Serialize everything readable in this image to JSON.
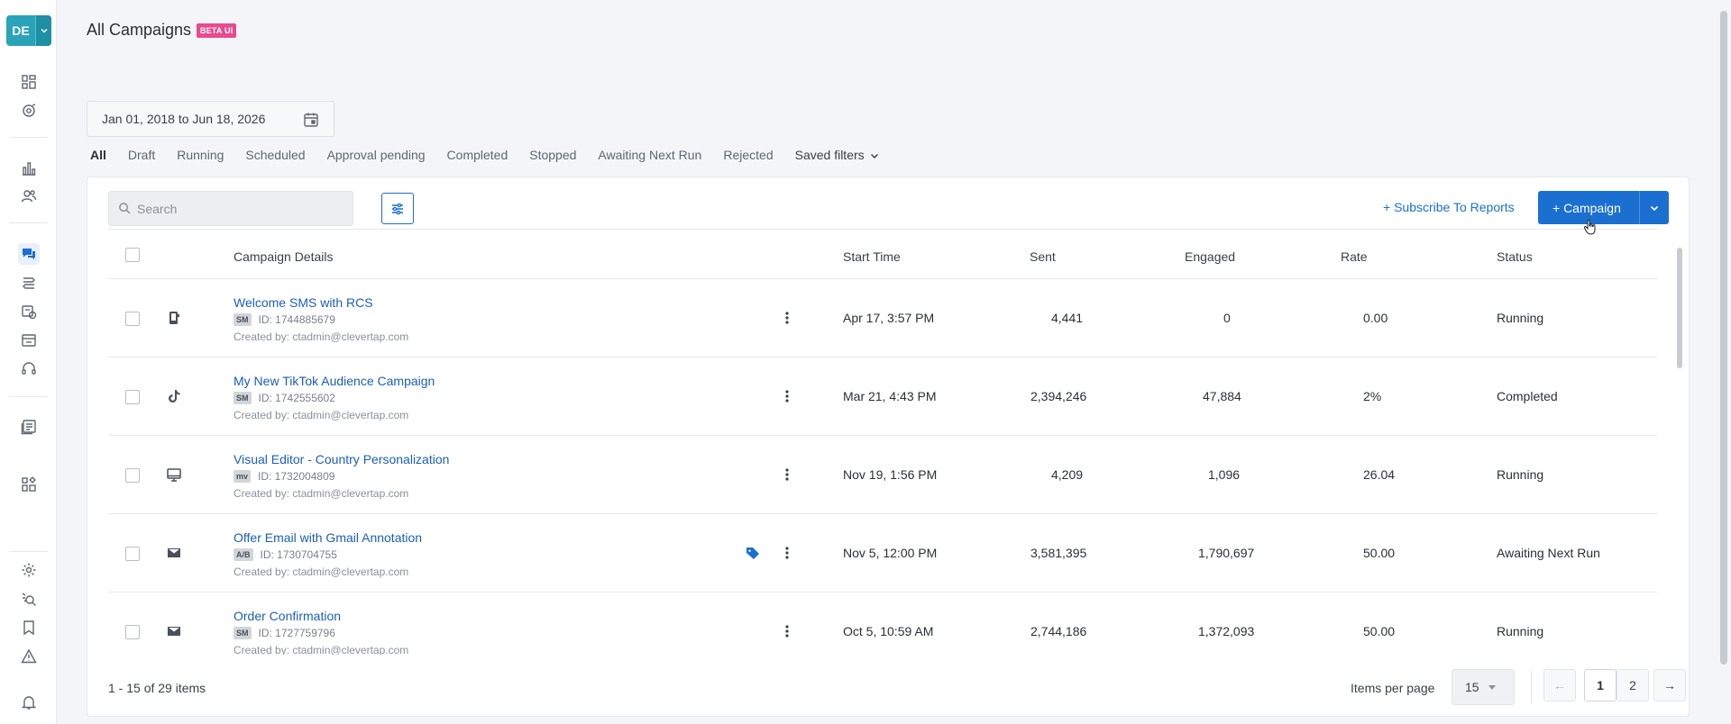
{
  "sidebar": {
    "workspace_initials": "DE",
    "icons": [
      "dashboard-icon",
      "segments-icon",
      "analytics-icon",
      "users-icon",
      "campaigns-icon",
      "journeys-icon",
      "offers-icon",
      "catalog-icon",
      "support-icon",
      "templates-icon",
      "apps-icon",
      "settings-icon",
      "search-debug-icon",
      "bookmark-icon",
      "alert-icon",
      "notifications-icon"
    ]
  },
  "header": {
    "title": "All Campaigns",
    "badge": "BETA UI"
  },
  "date_range": "Jan 01, 2018 to Jun 18, 2026",
  "filter_tabs": [
    "All",
    "Draft",
    "Running",
    "Scheduled",
    "Approval pending",
    "Completed",
    "Stopped",
    "Awaiting Next Run",
    "Rejected",
    "Saved filters"
  ],
  "toolbar": {
    "search_placeholder": "Search",
    "subscribe_label": "+ Subscribe To Reports",
    "campaign_label": "+  Campaign"
  },
  "table": {
    "columns": [
      "Campaign Details",
      "Start Time",
      "Sent",
      "Engaged",
      "Rate",
      "Status"
    ],
    "rows": [
      {
        "name": "Welcome SMS with RCS",
        "tag": "SM",
        "id": "ID: 1744885679",
        "creator": "Created by: ctadmin@clevertap.com",
        "channel_icon": "rcs-phone-icon",
        "start": "Apr 17, 3:57 PM",
        "sent": "4,441",
        "engaged": "0",
        "rate": "0.00",
        "status": "Running",
        "labelled": false
      },
      {
        "name": "My New TikTok Audience Campaign",
        "tag": "SM",
        "id": "ID: 1742555602",
        "creator": "Created by: ctadmin@clevertap.com",
        "channel_icon": "tiktok-icon",
        "start": "Mar 21, 4:43 PM",
        "sent": "2,394,246",
        "engaged": "47,884",
        "rate": "2%",
        "status": "Completed",
        "labelled": false
      },
      {
        "name": "Visual Editor - Country Personalization",
        "tag": "mv",
        "id": "ID: 1732004809",
        "creator": "Created by: ctadmin@clevertap.com",
        "channel_icon": "desktop-icon",
        "start": "Nov 19, 1:56 PM",
        "sent": "4,209",
        "engaged": "1,096",
        "rate": "26.04",
        "status": "Running",
        "labelled": false
      },
      {
        "name": "Offer Email with Gmail Annotation",
        "tag": "A/B",
        "id": "ID: 1730704755",
        "creator": "Created by: ctadmin@clevertap.com",
        "channel_icon": "email-icon",
        "start": "Nov 5, 12:00 PM",
        "sent": "3,581,395",
        "engaged": "1,790,697",
        "rate": "50.00",
        "status": "Awaiting Next Run",
        "labelled": true
      },
      {
        "name": "Order Confirmation",
        "tag": "SM",
        "id": "ID: 1727759796",
        "creator": "Created by: ctadmin@clevertap.com",
        "channel_icon": "email-icon",
        "start": "Oct 5, 10:59 AM",
        "sent": "2,744,186",
        "engaged": "1,372,093",
        "rate": "50.00",
        "status": "Running",
        "labelled": false
      }
    ]
  },
  "pagination": {
    "summary": "1 - 15 of 29 items",
    "items_per_page_label": "Items per page",
    "items_per_page": "15",
    "prev": "←",
    "pages": [
      "1",
      "2"
    ],
    "current_page": "1",
    "next": "→"
  },
  "colors": {
    "accent": "#1b6fd1",
    "workspace": "#2aa3b8",
    "beta_badge": "#e94a8f"
  }
}
